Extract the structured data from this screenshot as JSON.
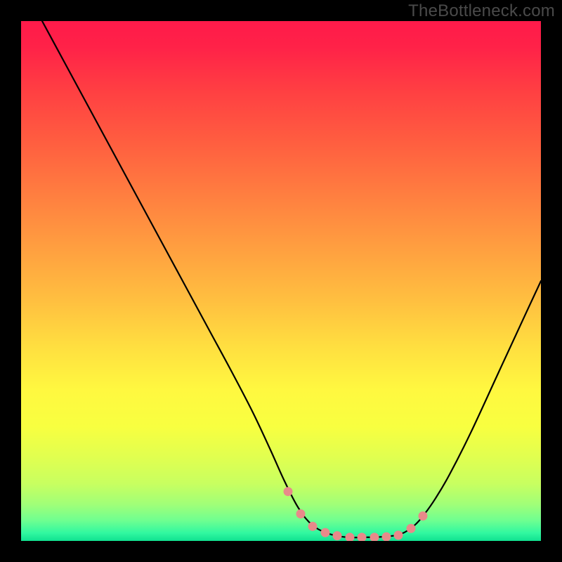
{
  "watermark": "TheBottleneck.com",
  "chart_data": {
    "type": "line",
    "title": "",
    "xlabel": "",
    "ylabel": "",
    "xlim": [
      0,
      740
    ],
    "ylim": [
      0,
      100
    ],
    "series": [
      {
        "name": "bottleneck-curve",
        "x": [
          30,
          60,
          90,
          120,
          150,
          180,
          210,
          240,
          270,
          300,
          330,
          355,
          375,
          395,
          415,
          440,
          465,
          490,
          515,
          540,
          560,
          575,
          590,
          610,
          640,
          680,
          720,
          740
        ],
        "values": [
          100,
          92.5,
          85,
          77.5,
          70,
          62.5,
          55,
          47.5,
          40,
          32.5,
          24.7,
          17.5,
          11.5,
          6.3,
          3.0,
          1.3,
          0.7,
          0.7,
          0.8,
          1.3,
          3.0,
          5.3,
          8.2,
          12.8,
          20.8,
          32.5,
          44.2,
          50
        ]
      }
    ],
    "highlight_dots": {
      "name": "recommended-range-markers",
      "color": "#e88a8a",
      "x": [
        380,
        398,
        415,
        433,
        450,
        468,
        485,
        503,
        520,
        537,
        555,
        572
      ],
      "values": [
        9.5,
        5.2,
        2.8,
        1.6,
        1.0,
        0.7,
        0.7,
        0.7,
        0.8,
        1.1,
        2.4,
        4.8
      ]
    },
    "gradient_stops": [
      {
        "offset": 0.0,
        "color": "#ff1a4a"
      },
      {
        "offset": 0.05,
        "color": "#ff2248"
      },
      {
        "offset": 0.14,
        "color": "#ff4142"
      },
      {
        "offset": 0.24,
        "color": "#ff6040"
      },
      {
        "offset": 0.34,
        "color": "#ff8040"
      },
      {
        "offset": 0.44,
        "color": "#ffa040"
      },
      {
        "offset": 0.54,
        "color": "#ffc040"
      },
      {
        "offset": 0.63,
        "color": "#ffe040"
      },
      {
        "offset": 0.71,
        "color": "#fff840"
      },
      {
        "offset": 0.78,
        "color": "#f8ff40"
      },
      {
        "offset": 0.84,
        "color": "#e0ff50"
      },
      {
        "offset": 0.89,
        "color": "#c8ff60"
      },
      {
        "offset": 0.93,
        "color": "#a0ff78"
      },
      {
        "offset": 0.96,
        "color": "#70ff90"
      },
      {
        "offset": 0.985,
        "color": "#30f8a0"
      },
      {
        "offset": 1.0,
        "color": "#10e090"
      }
    ]
  },
  "colors": {
    "watermark": "#4a4a4a",
    "curve": "#000000",
    "dot": "#e88a8a",
    "frame": "#000000"
  }
}
